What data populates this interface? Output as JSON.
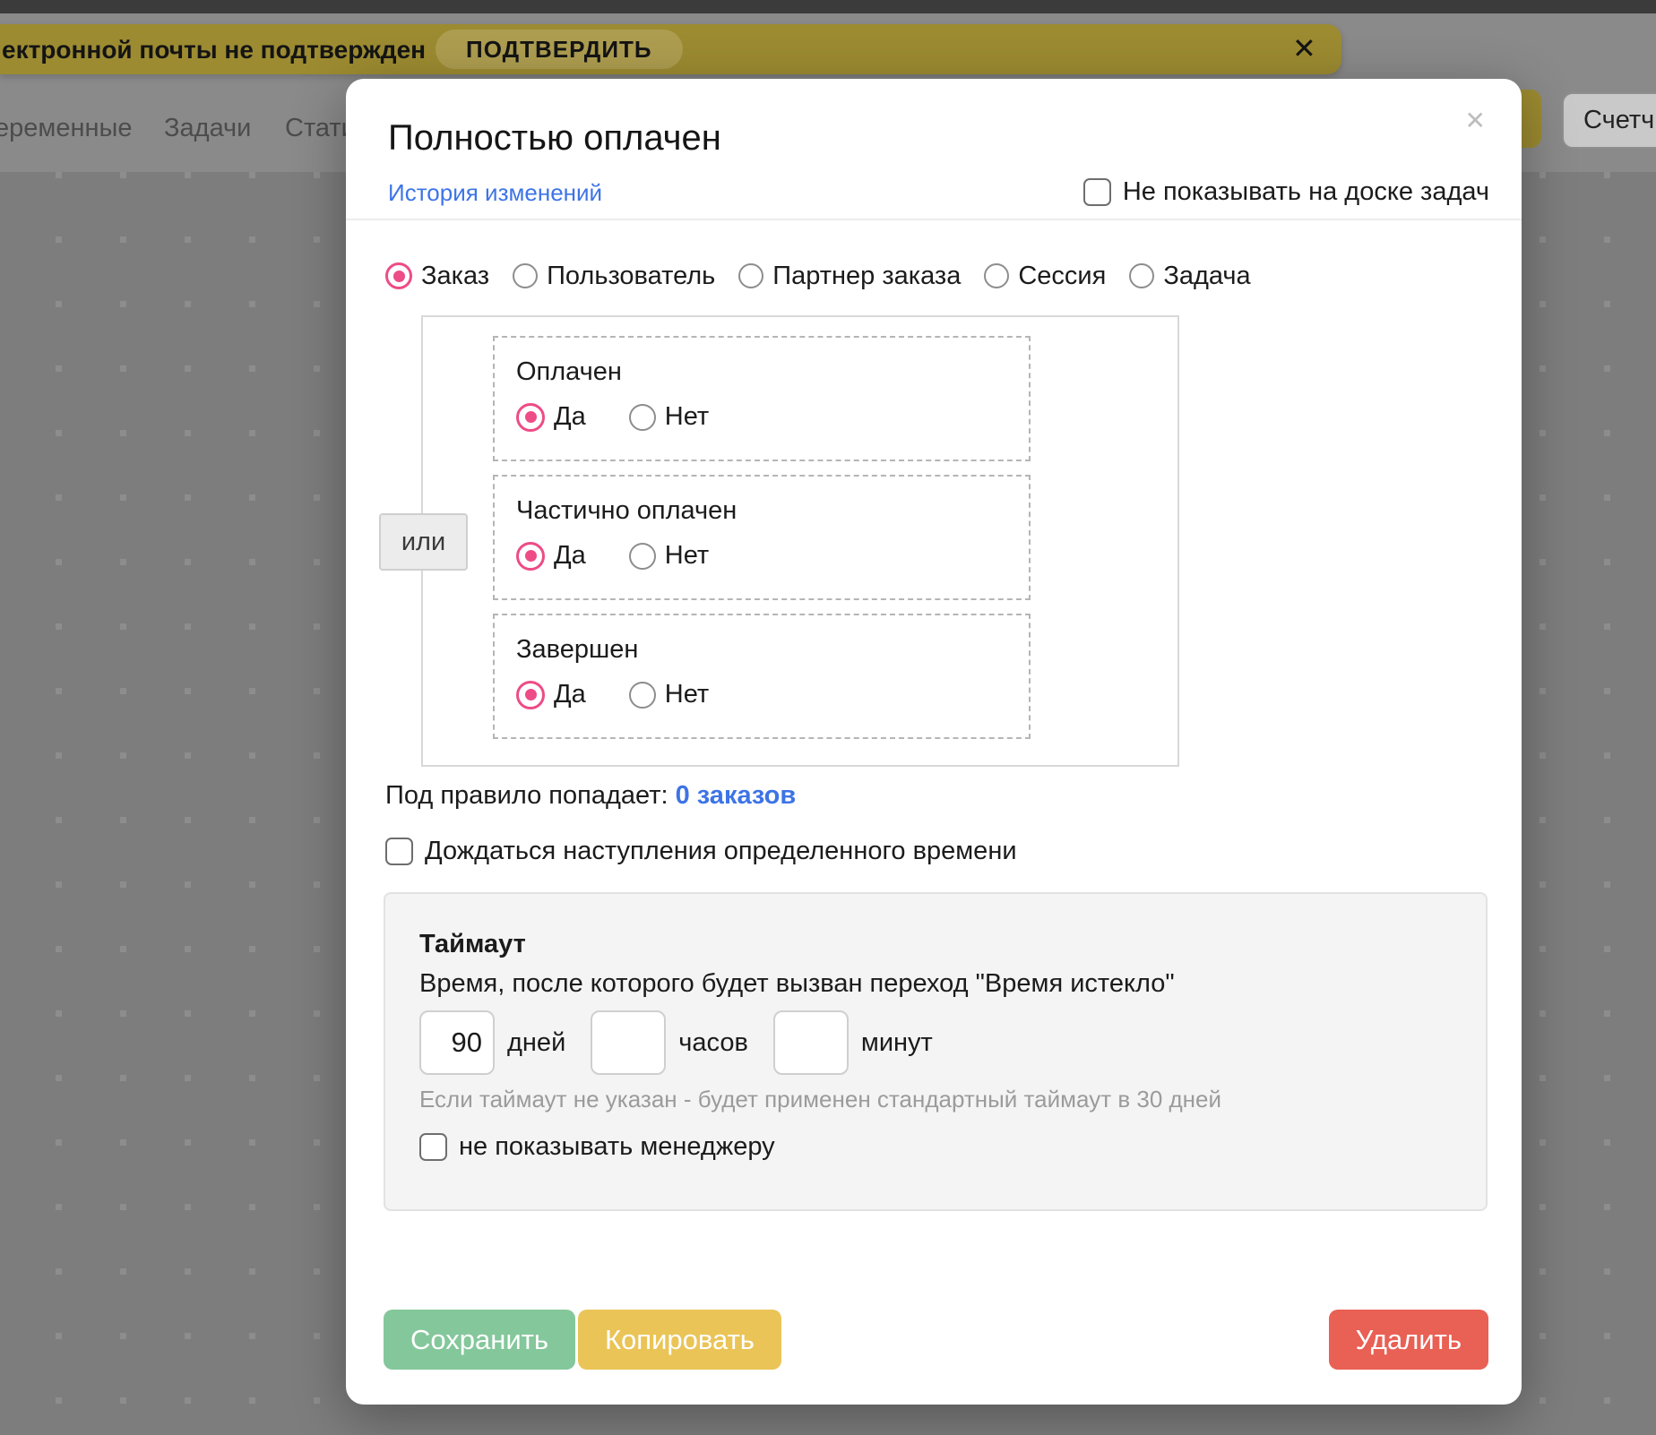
{
  "banner": {
    "message": "ектронной почты не подтвержден",
    "confirm_label": "ПОДТВЕРДИТЬ",
    "close_icon": "✕"
  },
  "background": {
    "tabs": [
      "еременные",
      "Задачи",
      "Стати"
    ],
    "counter_label": "Счетч"
  },
  "modal": {
    "title": "Полностью оплачен",
    "history_link": "История изменений",
    "close_icon": "✕",
    "board_checkbox": {
      "label": "Не показывать на доске задач",
      "checked": false
    },
    "entity_radios": [
      {
        "label": "Заказ",
        "selected": true
      },
      {
        "label": "Пользователь",
        "selected": false
      },
      {
        "label": "Партнер заказа",
        "selected": false
      },
      {
        "label": "Сессия",
        "selected": false
      },
      {
        "label": "Задача",
        "selected": false
      }
    ],
    "or_label": "или",
    "conditions": [
      {
        "title": "Оплачен",
        "yes_label": "Да",
        "no_label": "Нет",
        "selected": "Да"
      },
      {
        "title": "Частично оплачен",
        "yes_label": "Да",
        "no_label": "Нет",
        "selected": "Да"
      },
      {
        "title": "Завершен",
        "yes_label": "Да",
        "no_label": "Нет",
        "selected": "Да"
      }
    ],
    "rule": {
      "label": "Под правило попадает:",
      "value_link": "0 заказов"
    },
    "wait_checkbox": {
      "label": "Дождаться наступления определенного времени",
      "checked": false
    },
    "timeout": {
      "title": "Таймаут",
      "description": "Время, после которого будет вызван переход \"Время истекло\"",
      "days": {
        "value": "90",
        "label": "дней"
      },
      "hours": {
        "value": "",
        "label": "часов"
      },
      "minutes": {
        "value": "",
        "label": "минут"
      },
      "hint": "Если таймаут не указан - будет применен стандартный таймаут в 30 дней",
      "manager_checkbox": {
        "label": "не показывать менеджеру",
        "checked": false
      }
    },
    "buttons": {
      "save": "Сохранить",
      "copy": "Копировать",
      "delete": "Удалить"
    }
  },
  "colors": {
    "accent_pink": "#ed4c87",
    "link_blue": "#3d74e6",
    "save_green": "#84c79b",
    "copy_yellow": "#eac457",
    "delete_red": "#e96054",
    "banner_olive": "#9c8b31",
    "canvas_gray": "#7d7d7d"
  }
}
